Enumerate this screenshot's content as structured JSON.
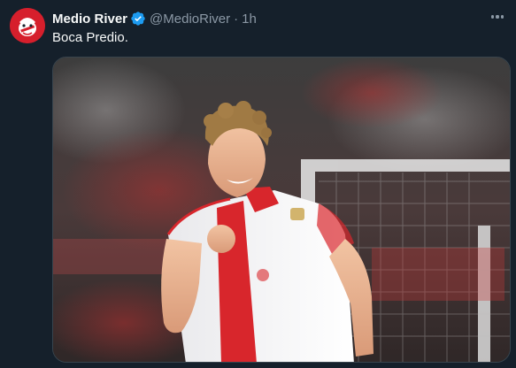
{
  "tweet": {
    "author": {
      "name": "Medio River",
      "handle": "@MedioRiver",
      "verified": true,
      "avatar_icon": "river-mascot-avatar"
    },
    "separator": "·",
    "time": "1h",
    "text": "Boca Predio.",
    "more_icon": "more-horizontal-icon",
    "media": {
      "kind": "photo",
      "subject": "football-player-celebrating"
    }
  },
  "colors": {
    "background": "#15202b",
    "text_primary": "#f7f9f9",
    "text_secondary": "#8b98a5",
    "verified_blue": "#1d9bf0",
    "avatar_red": "#d61f2c",
    "jersey_red": "#d8262c"
  }
}
